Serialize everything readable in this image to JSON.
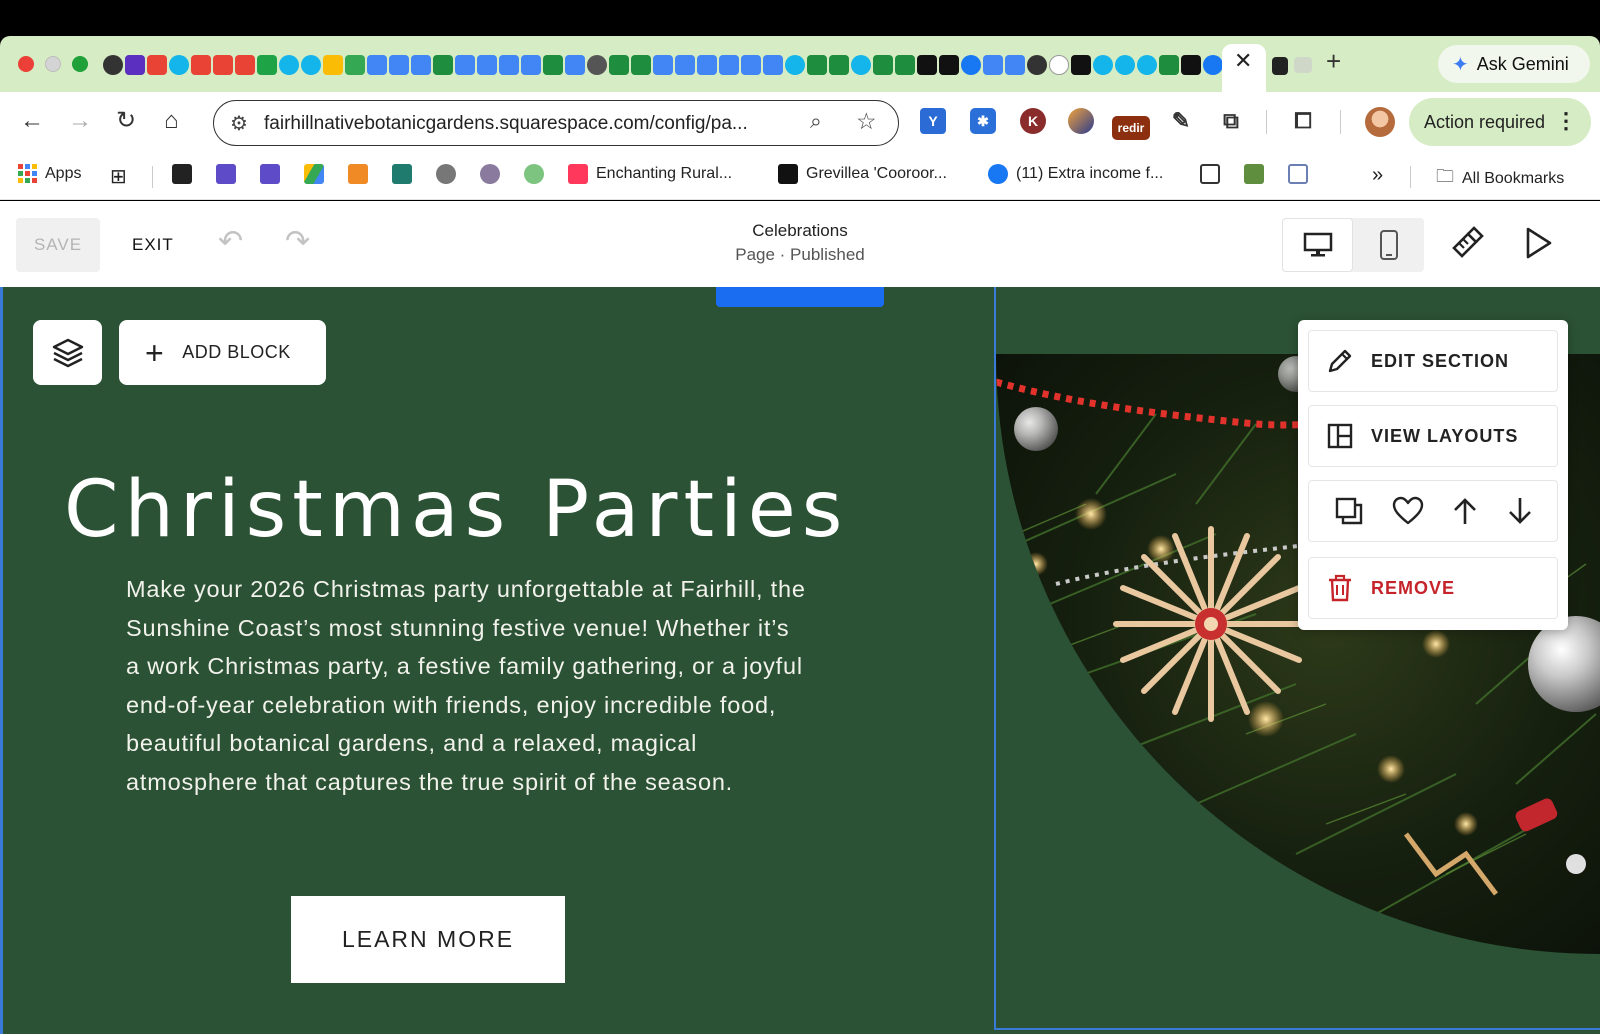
{
  "browser": {
    "active_tab_close": "✕",
    "new_tab": "+",
    "gemini_label": "Ask Gemini",
    "url": "fairhillnativebotanicgardens.squarespace.com/config/pa...",
    "action_required": "Action required",
    "ext_redir": "redir",
    "ext_k": "K",
    "bookmarks": {
      "apps": "Apps",
      "enchanting": "Enchanting Rural...",
      "grevillea": "Grevillea 'Cooroor...",
      "facebook": "(11) Extra income f...",
      "overflow": "»",
      "all_bookmarks": "All Bookmarks"
    }
  },
  "editor": {
    "save_label": "SAVE",
    "exit_label": "EXIT",
    "page_title": "Celebrations",
    "page_status": "Page · Published"
  },
  "canvas": {
    "add_block_label": "ADD BLOCK",
    "heading": "Christmas Parties",
    "body": "Make your 2026 Christmas party unforgettable at Fairhill, the Sunshine Coast’s most stunning festive venue! Whether it’s a work Christmas party, a festive family gathering, or a joyful end-of-year celebration with friends, enjoy incredible food, beautiful botanical gardens, and a relaxed, magical atmosphere that captures the true spirit of the season.",
    "learn_more_label": "LEARN MORE"
  },
  "section_menu": {
    "edit_section": "EDIT SECTION",
    "view_layouts": "VIEW LAYOUTS",
    "remove": "REMOVE"
  },
  "colors": {
    "section_bg": "#2b5234",
    "accent_blue": "#1a6cf0",
    "remove_red": "#c5242b",
    "chrome_tabstrip": "#d6ecc4"
  }
}
